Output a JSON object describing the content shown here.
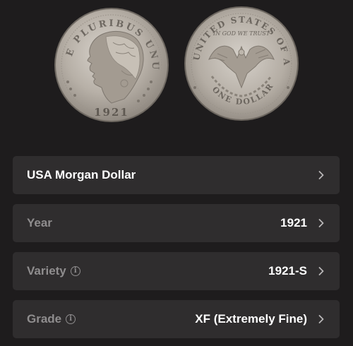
{
  "coins": {
    "obverse_name": "obverse-coin",
    "reverse_name": "reverse-coin",
    "obverse_legend": "E PLURIBUS UNUM",
    "obverse_date": "1921",
    "reverse_legend": "UNITED STATES OF AMERICA",
    "reverse_motto": "IN GOD WE TRUST",
    "reverse_denomination": "ONE DOLLAR"
  },
  "rows": {
    "name": {
      "label": "USA Morgan Dollar"
    },
    "year": {
      "label": "Year",
      "value": "1921"
    },
    "variety": {
      "label": "Variety",
      "value": "1921-S"
    },
    "grade": {
      "label": "Grade",
      "value": "XF (Extremely Fine)"
    }
  },
  "icons": {
    "chevron": "chevron-right-icon",
    "info": "info-icon"
  },
  "colors": {
    "background": "#1e1c1d",
    "row_background": "#2f2d2e",
    "label_muted": "#8f8d8e",
    "text_primary": "#ffffff"
  }
}
